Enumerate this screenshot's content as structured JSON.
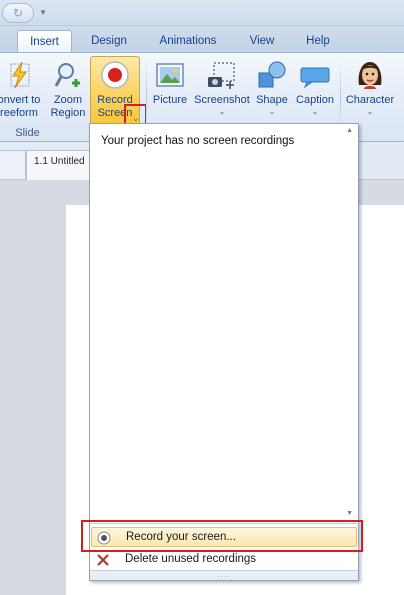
{
  "quick_access": {
    "undo_icon": "redo-arrow-icon",
    "customize_icon": "chevron-down-icon"
  },
  "tabs": [
    {
      "label": "Insert",
      "active": true
    },
    {
      "label": "Design",
      "active": false
    },
    {
      "label": "Animations",
      "active": false
    },
    {
      "label": "View",
      "active": false
    },
    {
      "label": "Help",
      "active": false
    }
  ],
  "ribbon": {
    "convert_freeform": {
      "line1": "onvert to",
      "line2": "reeform"
    },
    "zoom_region": {
      "line1": "Zoom",
      "line2": "Region"
    },
    "record_screen": {
      "line1": "Record",
      "line2": "Screen",
      "dropdown": "⌄"
    },
    "picture": {
      "label": "Picture"
    },
    "screenshot": {
      "label": "Screenshot",
      "dropdown": "⌄"
    },
    "shape": {
      "label": "Shape",
      "dropdown": "⌄"
    },
    "caption": {
      "label": "Caption",
      "dropdown": "⌄"
    },
    "character": {
      "label": "Character",
      "dropdown": "⌄"
    },
    "group_label": "Slide"
  },
  "document": {
    "tab_label": "1.1 Untitled"
  },
  "dropdown": {
    "empty_message": "Your project has no screen recordings",
    "record_item": "Record your screen...",
    "delete_item": "Delete unused recordings",
    "grip": "....",
    "scroll_up": "▲",
    "scroll_down": "▼"
  },
  "colors": {
    "highlight": "#d0201f",
    "selected_button": "#fbd66a",
    "ribbon": "#e4ecf7"
  }
}
